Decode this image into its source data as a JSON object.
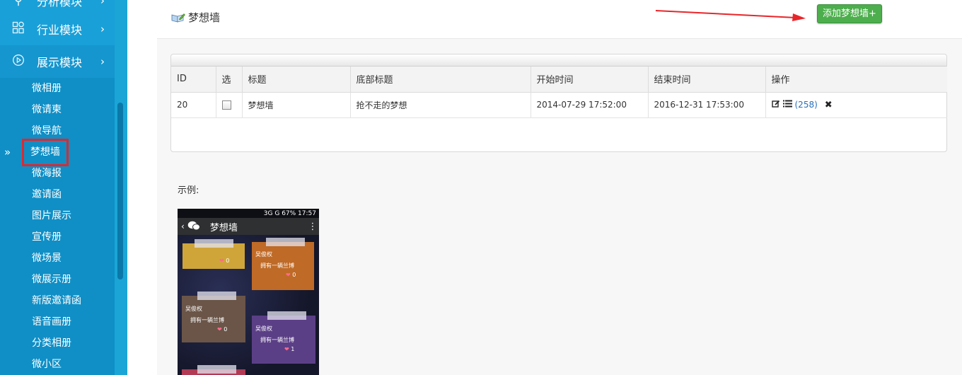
{
  "sidebar": {
    "modules": [
      {
        "label": "分析模块",
        "icon": "stats-icon"
      },
      {
        "label": "行业模块",
        "icon": "grid-icon"
      },
      {
        "label": "展示模块",
        "icon": "play-circle-icon"
      }
    ],
    "items": [
      "微相册",
      "微请柬",
      "微导航",
      "梦想墙",
      "微海报",
      "邀请函",
      "图片展示",
      "宣传册",
      "微场景",
      "微展示册",
      "新版邀请函",
      "语音画册",
      "分类相册",
      "微小区"
    ],
    "current_marker": "»"
  },
  "header": {
    "title": "梦想墙",
    "add_button": "添加梦想墙+"
  },
  "table": {
    "columns": [
      "ID",
      "选",
      "标题",
      "底部标题",
      "开始时间",
      "结束时间",
      "操作"
    ],
    "rows": [
      {
        "id": "20",
        "title": "梦想墙",
        "bottom_title": "抢不走的梦想",
        "start": "2014-07-29 17:52:00",
        "end": "2016-12-31 17:53:00",
        "count": "(258)"
      }
    ]
  },
  "example": {
    "label": "示例:",
    "phone": {
      "status": "3G   G   67%   17:57",
      "back": "‹",
      "title": "梦想墙",
      "more": "⋮",
      "notes": [
        {
          "who": "",
          "text": "",
          "likes": "0"
        },
        {
          "who": "吴俊权",
          "text": "拥有一辆兰博",
          "likes": "0"
        },
        {
          "who": "吴俊权",
          "text": "拥有一辆兰博",
          "likes": "0"
        },
        {
          "who": "吴俊权",
          "text": "拥有一辆兰博",
          "likes": "1"
        }
      ]
    }
  },
  "colors": {
    "sidebar": "#1aa5d6",
    "button_green": "#4cae4c",
    "highlight_red": "#e0282e",
    "link_blue": "#2a6fb8"
  }
}
